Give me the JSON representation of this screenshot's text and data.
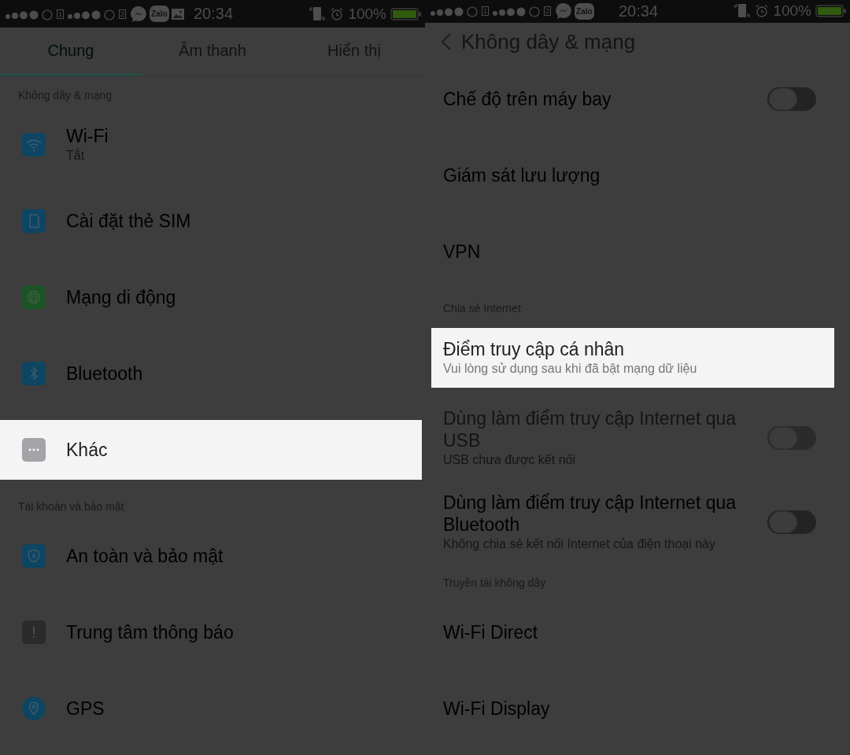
{
  "screens": [
    {
      "status_bar": {
        "sims": [
          "1",
          "2"
        ],
        "apps": [
          {
            "kind": "messenger"
          },
          {
            "kind": "zalo",
            "label": "Zalo"
          },
          {
            "kind": "gallery"
          }
        ],
        "time": "20:34",
        "battery": "100%"
      },
      "tabs": [
        {
          "label": "Chung",
          "selected": true
        },
        {
          "label": "Âm thanh",
          "selected": false
        },
        {
          "label": "Hiển thị",
          "selected": false
        }
      ],
      "sections": [
        {
          "header": "Không dây & mạng",
          "items": [
            {
              "title": "Wi-Fi",
              "subtitle": "Tắt",
              "kind": "wifi",
              "color": "#0d4563",
              "selected": false
            },
            {
              "title": "Cài đặt thẻ SIM",
              "kind": "sim",
              "color": "#0d4563",
              "selected": false
            },
            {
              "title": "Mạng di động",
              "kind": "globe",
              "color": "#1c5426",
              "selected": false
            },
            {
              "title": "Bluetooth",
              "kind": "bluetooth",
              "color": "#0d4563",
              "selected": false
            },
            {
              "title": "Khác",
              "kind": "more",
              "color": "#a3a3a8",
              "selected": true
            }
          ]
        },
        {
          "header": "Tài khoản và bảo mật",
          "items": [
            {
              "title": "An toàn và bảo mật",
              "kind": "shield",
              "color": "#0d4563",
              "selected": false
            },
            {
              "title": "Trung tâm thông báo",
              "kind": "alert",
              "color": "#2b2b2d",
              "selected": false
            },
            {
              "title": "GPS",
              "kind": "location",
              "color": "#0d4563",
              "selected": false
            }
          ]
        }
      ]
    },
    {
      "status_bar": {
        "sims": [
          "1",
          "2"
        ],
        "apps": [
          {
            "kind": "messenger"
          },
          {
            "kind": "zalo",
            "label": "Zalo"
          }
        ],
        "time": "20:34",
        "battery": "100%"
      },
      "title": "Không dây & mạng",
      "sections": [
        {
          "items": [
            {
              "title": "Chế độ trên máy bay",
              "toggle": {
                "on": false
              },
              "selected": false
            },
            {
              "title": "Giám sát lưu lượng",
              "selected": false
            },
            {
              "title": "VPN",
              "selected": false
            }
          ]
        },
        {
          "header": "Chia sẻ Internet",
          "items": [
            {
              "title": "Điểm truy cập cá nhân",
              "subtitle": "Vui lòng sử dụng sau khi đã bật mạng dữ liệu",
              "selected": true
            },
            {
              "title": "Dùng làm điểm truy cập Internet qua USB",
              "subtitle": "USB chưa được kết nối",
              "toggle": {
                "on": false
              },
              "disabled": true,
              "selected": false
            },
            {
              "title": "Dùng làm điểm truy cập Internet qua Bluetooth",
              "subtitle": "Không chia sẻ kết nối Internet của điện thoại này",
              "toggle": {
                "on": false
              },
              "disabled": false,
              "selected": false
            }
          ]
        },
        {
          "header": "Truyền tải không dây",
          "items": [
            {
              "title": "Wi-Fi Direct",
              "selected": false
            },
            {
              "title": "Wi-Fi Display",
              "selected": false
            }
          ]
        }
      ]
    }
  ]
}
